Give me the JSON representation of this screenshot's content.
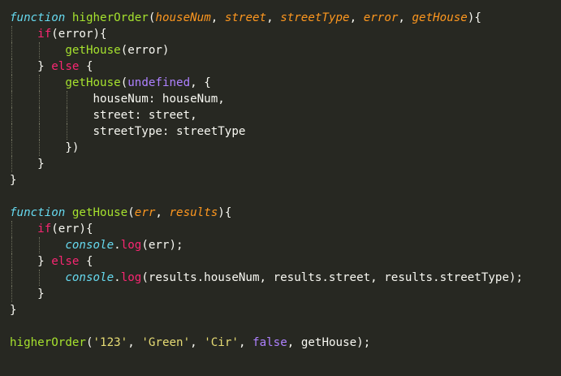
{
  "editor": {
    "theme_colors": {
      "background": "#272822",
      "plain": "#f8f8f2",
      "keyword_blue": "#66d9ef",
      "function_green": "#a6e22e",
      "param_orange": "#fd971f",
      "keyword_pink": "#f92672",
      "constant_purple": "#ae81ff",
      "string_yellow": "#e6db74"
    },
    "lines": [
      {
        "guides": [],
        "tokens": [
          {
            "t": "function",
            "c": "kw-italic"
          },
          {
            "t": " ",
            "c": "plain"
          },
          {
            "t": "higherOrder",
            "c": "fn"
          },
          {
            "t": "(",
            "c": "plain"
          },
          {
            "t": "houseNum",
            "c": "param"
          },
          {
            "t": ", ",
            "c": "plain"
          },
          {
            "t": "street",
            "c": "param"
          },
          {
            "t": ", ",
            "c": "plain"
          },
          {
            "t": "streetType",
            "c": "param"
          },
          {
            "t": ", ",
            "c": "plain"
          },
          {
            "t": "error",
            "c": "param"
          },
          {
            "t": ", ",
            "c": "plain"
          },
          {
            "t": "getHouse",
            "c": "param"
          },
          {
            "t": "){",
            "c": "plain"
          }
        ]
      },
      {
        "guides": [
          0
        ],
        "tokens": [
          {
            "t": "    ",
            "c": "plain"
          },
          {
            "t": "if",
            "c": "kw"
          },
          {
            "t": "(error){",
            "c": "plain"
          }
        ]
      },
      {
        "guides": [
          0,
          1
        ],
        "tokens": [
          {
            "t": "        ",
            "c": "plain"
          },
          {
            "t": "getHouse",
            "c": "fn"
          },
          {
            "t": "(error)",
            "c": "plain"
          }
        ]
      },
      {
        "guides": [
          0
        ],
        "tokens": [
          {
            "t": "    } ",
            "c": "plain"
          },
          {
            "t": "else",
            "c": "kw"
          },
          {
            "t": " {",
            "c": "plain"
          }
        ]
      },
      {
        "guides": [
          0,
          1
        ],
        "tokens": [
          {
            "t": "        ",
            "c": "plain"
          },
          {
            "t": "getHouse",
            "c": "fn"
          },
          {
            "t": "(",
            "c": "plain"
          },
          {
            "t": "undefined",
            "c": "const"
          },
          {
            "t": ", {",
            "c": "plain"
          }
        ]
      },
      {
        "guides": [
          0,
          1,
          2
        ],
        "tokens": [
          {
            "t": "            houseNum: houseNum,",
            "c": "plain"
          }
        ]
      },
      {
        "guides": [
          0,
          1,
          2
        ],
        "tokens": [
          {
            "t": "            street: street,",
            "c": "plain"
          }
        ]
      },
      {
        "guides": [
          0,
          1,
          2
        ],
        "tokens": [
          {
            "t": "            streetType: streetType",
            "c": "plain"
          }
        ]
      },
      {
        "guides": [
          0,
          1
        ],
        "tokens": [
          {
            "t": "        })",
            "c": "plain"
          }
        ]
      },
      {
        "guides": [
          0
        ],
        "tokens": [
          {
            "t": "    }",
            "c": "plain"
          }
        ]
      },
      {
        "guides": [],
        "tokens": [
          {
            "t": "}",
            "c": "plain"
          }
        ]
      },
      {
        "guides": [],
        "tokens": []
      },
      {
        "guides": [],
        "tokens": [
          {
            "t": "function",
            "c": "kw-italic"
          },
          {
            "t": " ",
            "c": "plain"
          },
          {
            "t": "getHouse",
            "c": "fn"
          },
          {
            "t": "(",
            "c": "plain"
          },
          {
            "t": "err",
            "c": "param"
          },
          {
            "t": ", ",
            "c": "plain"
          },
          {
            "t": "results",
            "c": "param"
          },
          {
            "t": "){",
            "c": "plain"
          }
        ]
      },
      {
        "guides": [
          0
        ],
        "tokens": [
          {
            "t": "    ",
            "c": "plain"
          },
          {
            "t": "if",
            "c": "kw"
          },
          {
            "t": "(err){",
            "c": "plain"
          }
        ]
      },
      {
        "guides": [
          0,
          1
        ],
        "tokens": [
          {
            "t": "        ",
            "c": "plain"
          },
          {
            "t": "console",
            "c": "kw-italic"
          },
          {
            "t": ".",
            "c": "plain"
          },
          {
            "t": "log",
            "c": "kw"
          },
          {
            "t": "(err);",
            "c": "plain"
          }
        ]
      },
      {
        "guides": [
          0
        ],
        "tokens": [
          {
            "t": "    } ",
            "c": "plain"
          },
          {
            "t": "else",
            "c": "kw"
          },
          {
            "t": " {",
            "c": "plain"
          }
        ]
      },
      {
        "guides": [
          0,
          1
        ],
        "tokens": [
          {
            "t": "        ",
            "c": "plain"
          },
          {
            "t": "console",
            "c": "kw-italic"
          },
          {
            "t": ".",
            "c": "plain"
          },
          {
            "t": "log",
            "c": "kw"
          },
          {
            "t": "(results.houseNum, results.street, results.streetType);",
            "c": "plain"
          }
        ]
      },
      {
        "guides": [
          0
        ],
        "tokens": [
          {
            "t": "    }",
            "c": "plain"
          }
        ]
      },
      {
        "guides": [],
        "tokens": [
          {
            "t": "}",
            "c": "plain"
          }
        ]
      },
      {
        "guides": [],
        "tokens": []
      },
      {
        "guides": [],
        "tokens": [
          {
            "t": "higherOrder",
            "c": "fn"
          },
          {
            "t": "(",
            "c": "plain"
          },
          {
            "t": "'123'",
            "c": "str"
          },
          {
            "t": ", ",
            "c": "plain"
          },
          {
            "t": "'Green'",
            "c": "str"
          },
          {
            "t": ", ",
            "c": "plain"
          },
          {
            "t": "'Cir'",
            "c": "str"
          },
          {
            "t": ", ",
            "c": "plain"
          },
          {
            "t": "false",
            "c": "const"
          },
          {
            "t": ", getHouse);",
            "c": "plain"
          }
        ]
      }
    ]
  }
}
